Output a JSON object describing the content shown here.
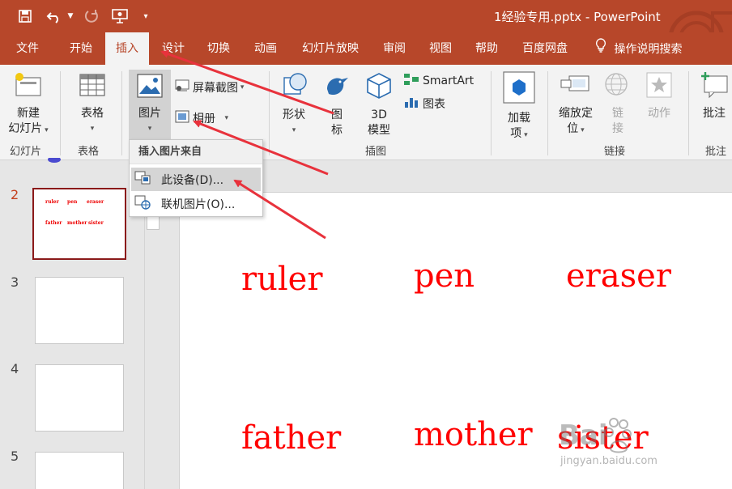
{
  "titlebar": {
    "document_name": "1经验专用.pptx",
    "separator": " - ",
    "app_name": "PowerPoint",
    "save_icon": "save-icon",
    "undo_icon": "undo-icon",
    "redo_icon": "redo-icon",
    "present_icon": "present-from-start-icon",
    "customize_icon": "customize-qat-icon"
  },
  "tabs": [
    {
      "label": "文件"
    },
    {
      "label": "开始"
    },
    {
      "label": "插入"
    },
    {
      "label": "设计"
    },
    {
      "label": "切换"
    },
    {
      "label": "动画"
    },
    {
      "label": "幻灯片放映"
    },
    {
      "label": "审阅"
    },
    {
      "label": "视图"
    },
    {
      "label": "帮助"
    },
    {
      "label": "百度网盘"
    }
  ],
  "active_tab": "插入",
  "tell_me": "操作说明搜索",
  "ribbon": {
    "new_slide_line1": "新建",
    "new_slide_line2": "幻灯片",
    "table": "表格",
    "pictures": "图片",
    "screenshot": "屏幕截图",
    "album": "相册",
    "shapes": "形状",
    "icons_line1": "图",
    "icons_line2": "标",
    "model_line1": "3D",
    "model_line2": "模型",
    "smartart": "SmartArt",
    "chart": "图表",
    "addins_line1": "加载",
    "addins_line2": "项",
    "zoom_line1": "缩放定",
    "zoom_line2": "位",
    "link_line1": "链",
    "link_line2": "接",
    "action": "动作",
    "comment": "批注",
    "groups": {
      "slides": "幻灯片",
      "tables": "表格",
      "illustrations": "插图",
      "links": "链接",
      "comments": "批注"
    }
  },
  "dropdown": {
    "header": "插入图片来自",
    "this_device": "此设备(D)...",
    "online_pictures": "联机图片(O)..."
  },
  "slides": {
    "numbers": [
      "2",
      "3",
      "4",
      "5"
    ],
    "thumb_words": [
      "ruler",
      "pen",
      "eraser",
      "father",
      "mother",
      "sister"
    ]
  },
  "slide_content": {
    "words": [
      "ruler",
      "pen",
      "eraser",
      "father",
      "mother",
      "sister"
    ]
  },
  "watermark": {
    "logo": "Bai",
    "url": "jingyan.baidu.com"
  },
  "colors": {
    "brand": "#b7472a",
    "word_color": "#ff0000",
    "arrow_color": "#e8323c",
    "selected_thumb_border": "#8b1a1a"
  }
}
